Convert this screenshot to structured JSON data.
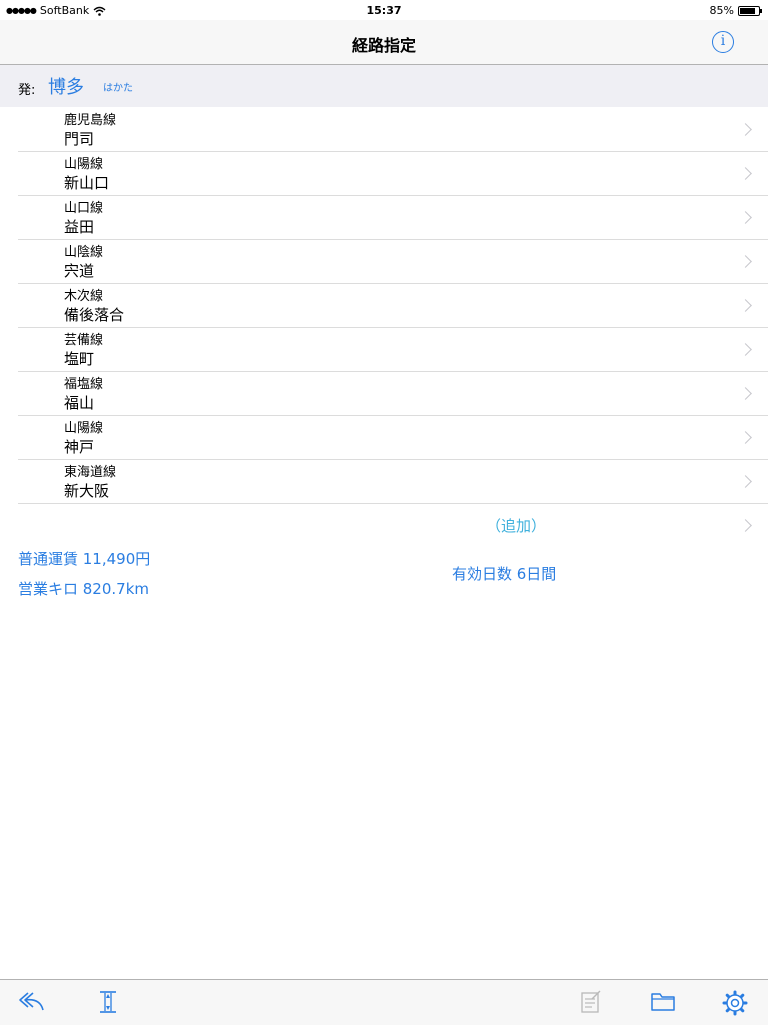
{
  "status_bar": {
    "signal": "●●●●●",
    "carrier": "SoftBank",
    "time": "15:37",
    "battery": "85%",
    "battery_level": 0.85
  },
  "nav": {
    "title": "経路指定"
  },
  "origin": {
    "label": "発:",
    "station": "博多",
    "reading": "はかた"
  },
  "routes": [
    {
      "line": "鹿児島線",
      "station": "門司"
    },
    {
      "line": "山陽線",
      "station": "新山口"
    },
    {
      "line": "山口線",
      "station": "益田"
    },
    {
      "line": "山陰線",
      "station": "宍道"
    },
    {
      "line": "木次線",
      "station": "備後落合"
    },
    {
      "line": "芸備線",
      "station": "塩町"
    },
    {
      "line": "福塩線",
      "station": "福山"
    },
    {
      "line": "山陽線",
      "station": "神戸"
    },
    {
      "line": "東海道線",
      "station": "新大阪"
    }
  ],
  "add_label": "（追加）",
  "summary": {
    "fare": "普通運賃  11,490円",
    "distance": "営業キロ  820.7km",
    "valid_days": "有効日数 6日間"
  },
  "colors": {
    "accent": "#2a7de1",
    "add": "#3fb0dc"
  },
  "toolbar_icons": [
    "reverse-icon",
    "route-marker-icon",
    "memo-icon",
    "folder-icon",
    "settings-gear-icon"
  ]
}
